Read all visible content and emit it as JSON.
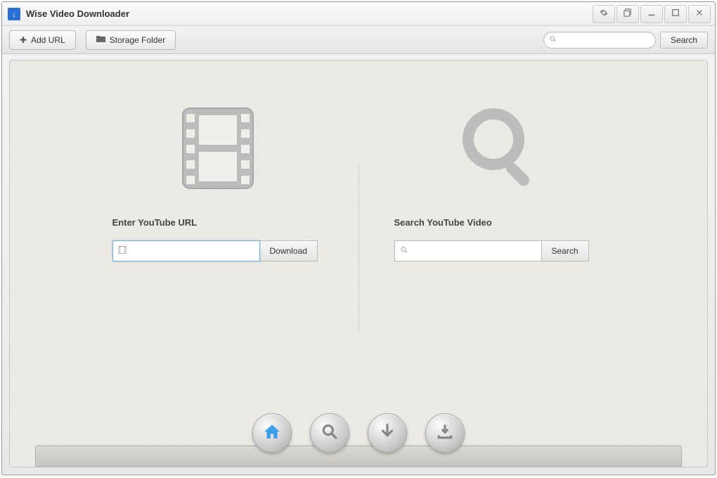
{
  "app": {
    "title": "Wise Video Downloader"
  },
  "toolbar": {
    "add_url_label": "Add URL",
    "storage_folder_label": "Storage Folder",
    "search_button_label": "Search",
    "search_placeholder": ""
  },
  "main": {
    "url_panel": {
      "label": "Enter YouTube URL",
      "button_label": "Download",
      "input_value": ""
    },
    "search_panel": {
      "label": "Search YouTube Video",
      "button_label": "Search",
      "input_value": ""
    }
  },
  "dock": {
    "buttons": [
      "home",
      "search",
      "download",
      "save"
    ],
    "active": "home"
  },
  "icons": {
    "settings": "gear-icon",
    "restore": "restore-icon",
    "minimize": "minimize-icon",
    "maximize": "maximize-icon",
    "close": "close-icon",
    "plus": "plus-icon",
    "folder": "folder-icon",
    "search": "search-icon",
    "film": "film-icon"
  },
  "colors": {
    "accent": "#3a9fe8",
    "border": "#bcbcbc",
    "bg_texture": "#eeece6"
  }
}
